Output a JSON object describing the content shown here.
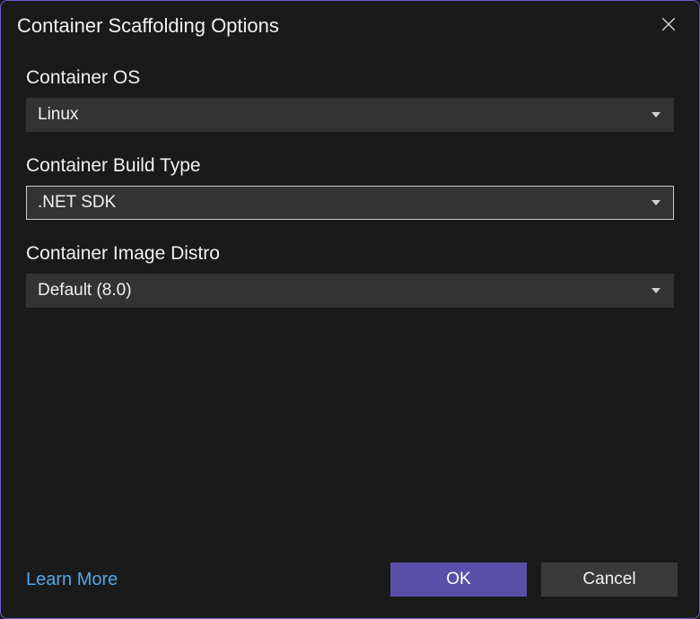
{
  "dialog": {
    "title": "Container Scaffolding Options"
  },
  "fields": {
    "os": {
      "label": "Container OS",
      "value": "Linux"
    },
    "buildType": {
      "label": "Container Build Type",
      "value": ".NET SDK"
    },
    "imageDistro": {
      "label": "Container Image Distro",
      "value": "Default (8.0)"
    }
  },
  "footer": {
    "learnMore": "Learn More",
    "ok": "OK",
    "cancel": "Cancel"
  }
}
